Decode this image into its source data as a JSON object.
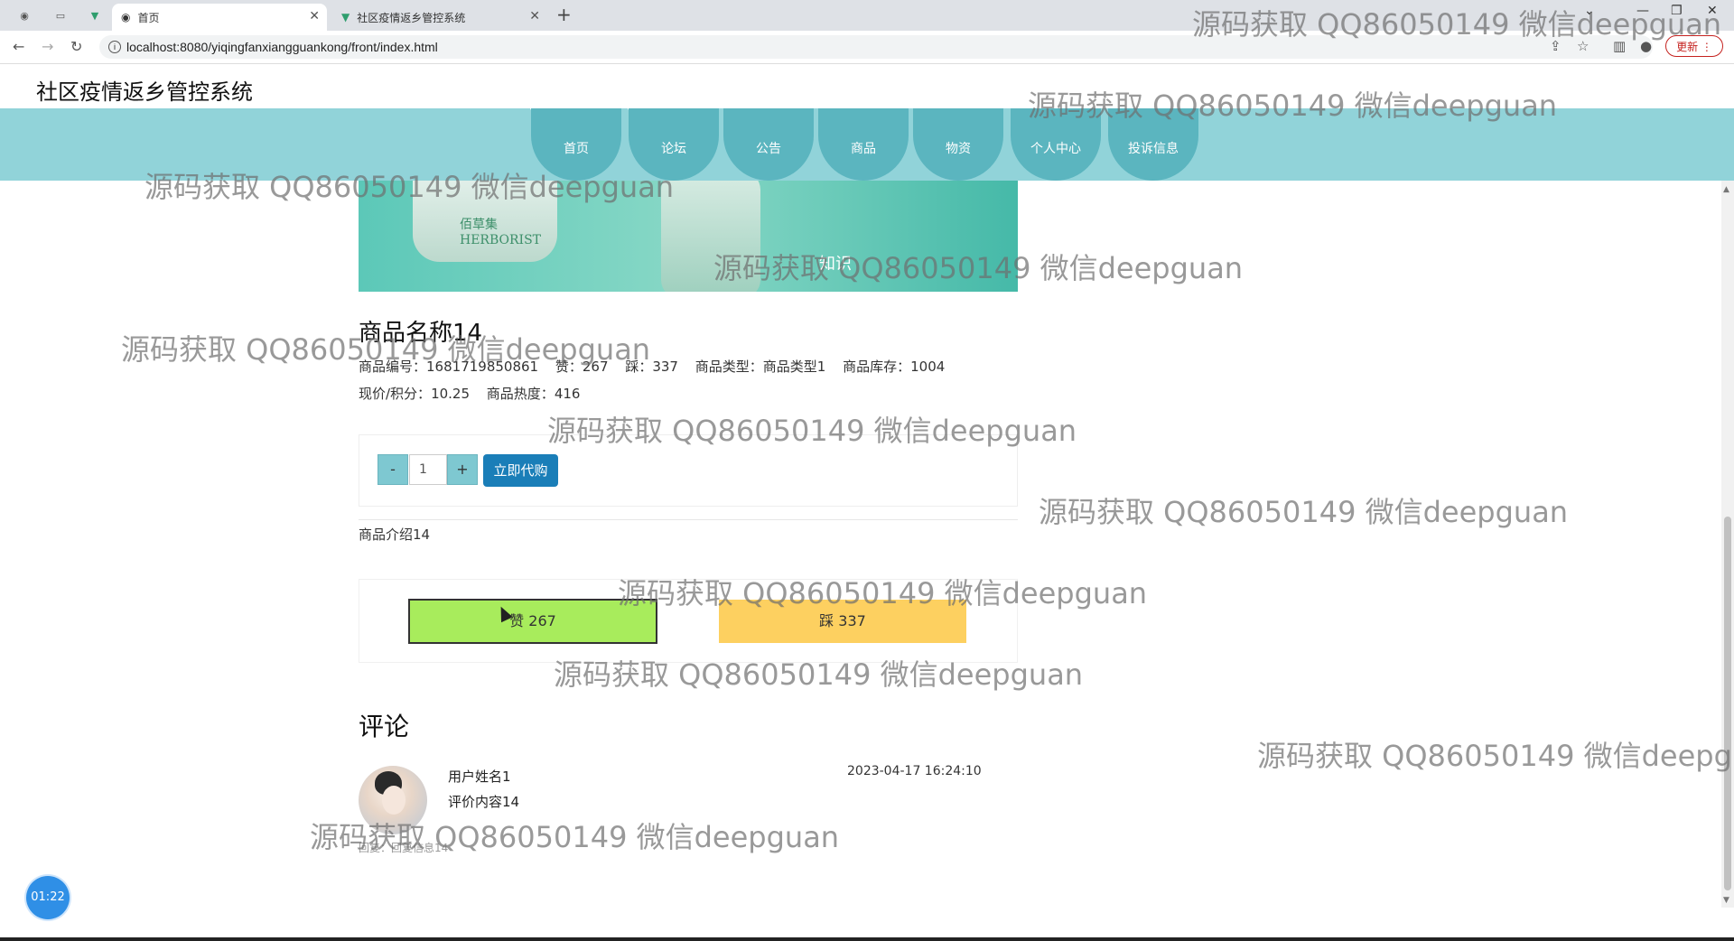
{
  "browser": {
    "tabs": [
      {
        "title": "首页",
        "active": true
      },
      {
        "title": "社区疫情返乡管控系统",
        "active": false
      }
    ],
    "url": "localhost:8080/yiqingfanxiangguankong/front/index.html",
    "update_label": "更新"
  },
  "site": {
    "title": "社区疫情返乡管控系统",
    "nav": [
      "首页",
      "论坛",
      "公告",
      "商品",
      "物资",
      "个人中心",
      "投诉信息"
    ]
  },
  "product": {
    "image_caption": "知识",
    "image_label": "佰草集 HERBORIST",
    "name": "商品名称14",
    "meta1": [
      {
        "label": "商品编号：",
        "value": "1681719850861"
      },
      {
        "label": "赞：",
        "value": "267"
      },
      {
        "label": "踩：",
        "value": "337"
      },
      {
        "label": "商品类型：",
        "value": "商品类型1"
      },
      {
        "label": "商品库存：",
        "value": "1004"
      }
    ],
    "meta2": [
      {
        "label": "现价/积分：",
        "value": "10.25"
      },
      {
        "label": "商品热度：",
        "value": "416"
      }
    ],
    "qty_minus": "-",
    "qty_value": "1",
    "qty_plus": "+",
    "buy_label": "立即代购",
    "intro": "商品介绍14",
    "like_label": "赞  267",
    "dislike_label": "踩  337"
  },
  "comments": {
    "title": "评论",
    "items": [
      {
        "user": "用户姓名1",
        "content": "评价内容14",
        "time": "2023-04-17 16:24:10",
        "reply": "回复：回复信息14"
      }
    ]
  },
  "timer": "01:22",
  "watermark": "源码获取 QQ86050149 微信deepguan"
}
